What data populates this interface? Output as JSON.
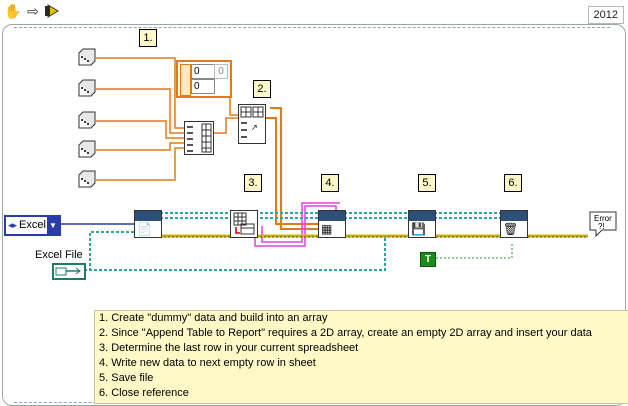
{
  "toolbar": {
    "icons": [
      "hand-icon",
      "arrow-right-icon",
      "highlight-execution-icon"
    ],
    "version_label": "2012"
  },
  "diagram": {
    "step_labels": [
      "1.",
      "2.",
      "3.",
      "4.",
      "5.",
      "6."
    ],
    "excel_control": {
      "value": "Excel"
    },
    "excel_file_label": "Excel File",
    "bool_constant": "T",
    "array_values": [
      "0",
      "0",
      "0"
    ],
    "error_indicator_label": "Error ?!"
  },
  "note": {
    "lines": [
      "1. Create \"dummy\" data and build into an array",
      "2. Since \"Append Table to Report\" requires a 2D array, create an empty 2D array and insert your data",
      "3. Determine the last row in your current spreadsheet",
      "4. Write new data to next empty row in sheet",
      "5. Save file",
      "6. Close reference"
    ]
  },
  "colors": {
    "wire_orange": "#e07b1a",
    "wire_teal": "#2aa5a0",
    "wire_yellow_error": "#c8b400",
    "wire_pink": "#e040e0",
    "wire_blue": "#2a3ca8"
  }
}
